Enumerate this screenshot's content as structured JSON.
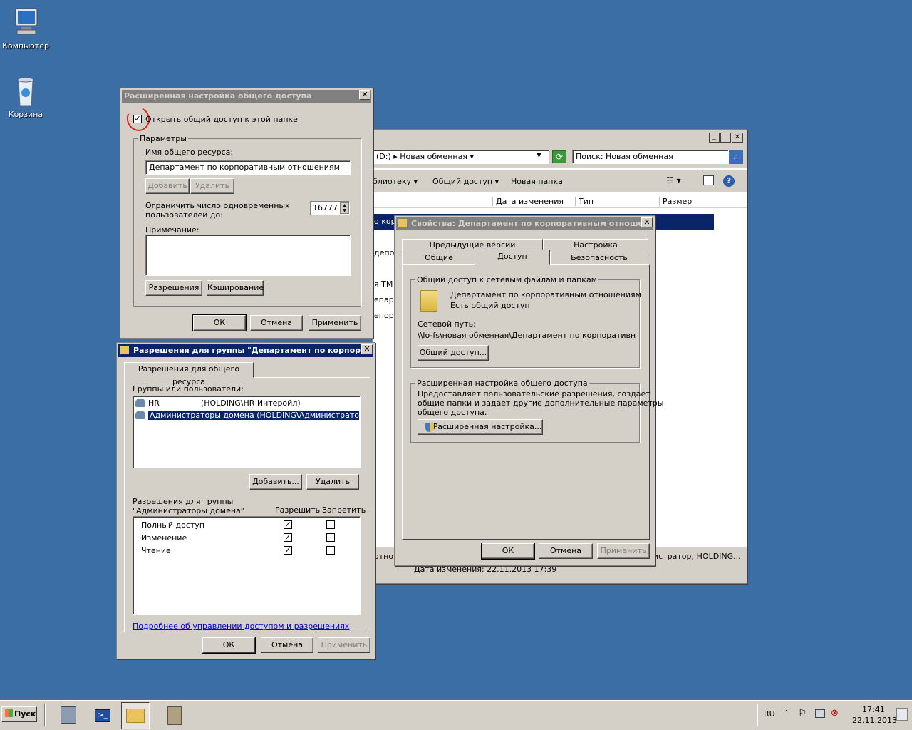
{
  "desktop": {
    "computer_label": "Компьютер",
    "recycle_label": "Корзина"
  },
  "explorer": {
    "address_part1": "(D:)",
    "address_part2": "Новая обменная",
    "search_placeholder": "Поиск: Новая обменная",
    "toolbar": [
      "блиотеку ▾",
      "Общий доступ ▾",
      "Новая папка"
    ],
    "columns": [
      "Дата изменения",
      "Тип",
      "Размер"
    ],
    "rows": [
      "о кор",
      "депор",
      "я ТМ",
      "епарт",
      "епорт"
    ],
    "details_text": "отнош",
    "details_right": "истратор; HOLDING...",
    "details_date": "Дата изменения: 22.11.2013 17:39"
  },
  "adv": {
    "title": "Расширенная настройка общего доступа",
    "share_checkbox": "Открыть общий доступ к этой папке",
    "params_legend": "Параметры",
    "share_name_label": "Имя общего ресурса:",
    "share_name_value": "Департамент по корпоративным отношениям",
    "add_btn": "Добавить",
    "remove_btn": "Удалить",
    "limit_label1": "Ограничить число одновременных",
    "limit_label2": "пользователей до:",
    "limit_value": "16777",
    "note_label": "Примечание:",
    "permissions_btn": "Разрешения",
    "caching_btn": "Кэширование",
    "ok": "ОК",
    "cancel": "Отмена",
    "apply": "Применить"
  },
  "perm": {
    "title": "Разрешения для группы \"Департамент по корпорат...",
    "tab": "Разрешения для общего ресурса",
    "groups_label": "Группы или пользователи:",
    "users": [
      {
        "name": "HR",
        "detail": "(HOLDING\\HR Интеройл)"
      },
      {
        "name": "Администраторы домена (HOLDING\\Администраторы ...",
        "detail": ""
      }
    ],
    "add": "Добавить...",
    "remove": "Удалить",
    "perm_for1": "Разрешения для группы",
    "perm_for2": "\"Администраторы домена\"",
    "allow": "Разрешить",
    "deny": "Запретить",
    "perms": [
      {
        "name": "Полный доступ",
        "allow": true,
        "deny": false
      },
      {
        "name": "Изменение",
        "allow": true,
        "deny": false
      },
      {
        "name": "Чтение",
        "allow": true,
        "deny": false
      }
    ],
    "link": "Подробнее об управлении доступом и разрешениях",
    "ok": "ОК",
    "cancel": "Отмена",
    "apply": "Применить"
  },
  "props": {
    "title": "Свойства: Департамент по корпоративным отношен...",
    "tabs_top": [
      "Предыдущие версии",
      "Настройка"
    ],
    "tabs_bottom": [
      "Общие",
      "Доступ",
      "Безопасность"
    ],
    "net_legend": "Общий доступ к сетевым файлам и папкам",
    "folder_name": "Департамент по корпоративным отношениям",
    "shared_status": "Есть общий доступ",
    "net_path_label": "Сетевой путь:",
    "net_path": "\\\\lo-fs\\новая обменная\\Департамент по корпоративным с",
    "share_btn": "Общий доступ...",
    "adv_legend": "Расширенная настройка общего доступа",
    "adv_desc1": "Предоставляет пользовательские разрешения, создает",
    "adv_desc2": "общие папки и задает другие дополнительные параметры",
    "adv_desc3": "общего доступа.",
    "adv_btn": "Расширенная настройка...",
    "ok": "ОК",
    "cancel": "Отмена",
    "apply": "Применить"
  },
  "taskbar": {
    "start": "Пуск",
    "lang": "RU",
    "time": "17:41",
    "date": "22.11.2013"
  }
}
